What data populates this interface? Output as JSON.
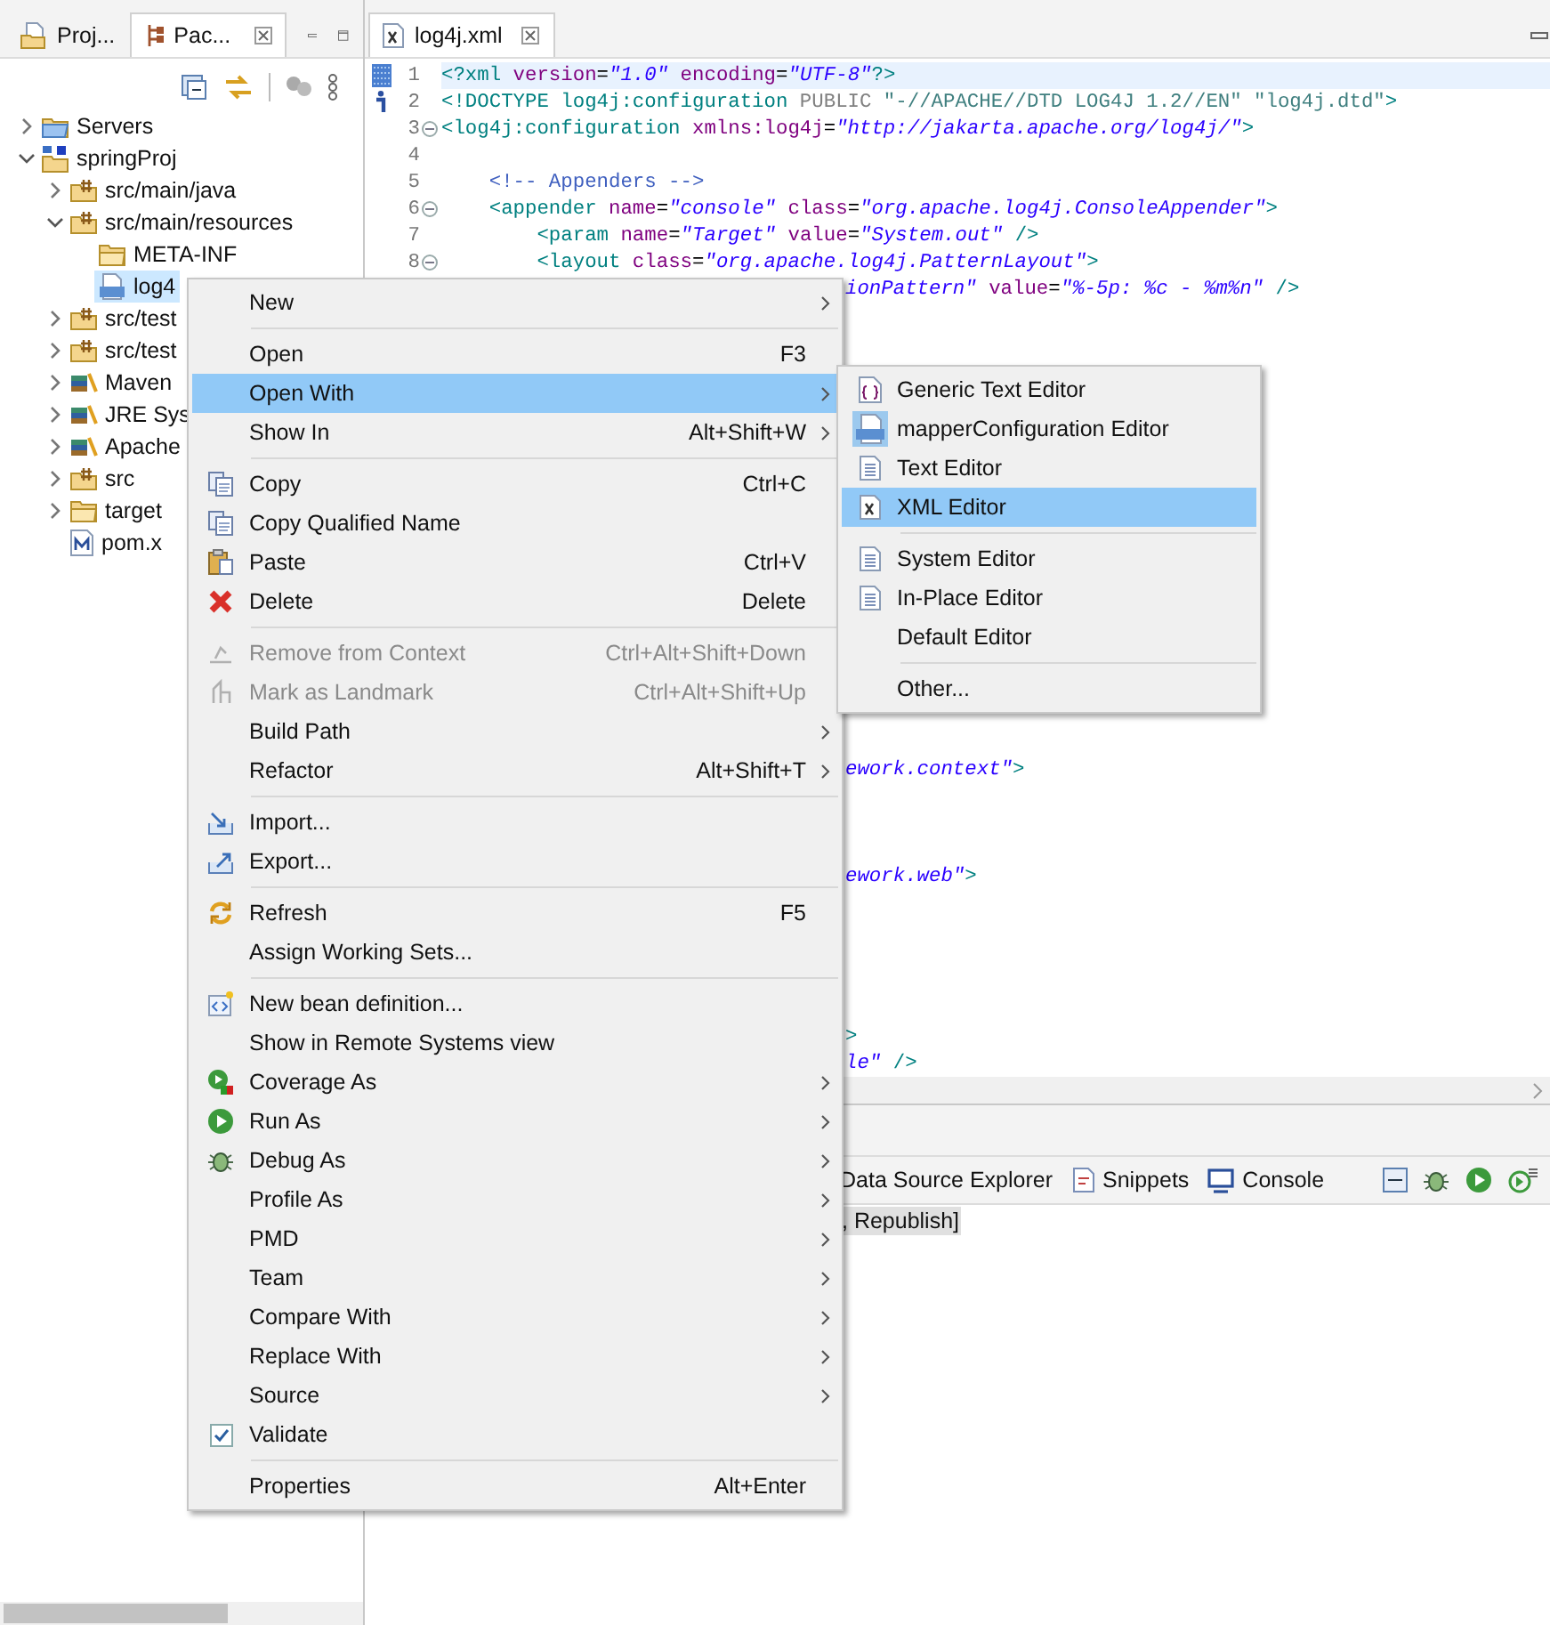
{
  "explorer": {
    "tabs": [
      {
        "label": "Proj...",
        "selected": false
      },
      {
        "label": "Pac...",
        "selected": true
      }
    ],
    "tree": [
      {
        "label": "Servers",
        "kind": "server-folder",
        "expanded": false,
        "selected": false
      },
      {
        "label": "springProj",
        "kind": "project",
        "expanded": true,
        "selected": false,
        "children": [
          {
            "label": "src/main/java",
            "kind": "package-folder",
            "expanded": false,
            "selected": false
          },
          {
            "label": "src/main/resources",
            "kind": "package-folder",
            "expanded": true,
            "selected": false,
            "children": [
              {
                "label": "META-INF",
                "kind": "folder",
                "selected": false
              },
              {
                "label": "log4",
                "kind": "config-file",
                "selected": true
              }
            ]
          },
          {
            "label": "src/test",
            "kind": "package-folder",
            "expanded": false,
            "selected": false
          },
          {
            "label": "src/test",
            "kind": "package-folder",
            "expanded": false,
            "selected": false
          },
          {
            "label": "Maven",
            "kind": "library",
            "expanded": false,
            "selected": false
          },
          {
            "label": "JRE Sys",
            "kind": "library",
            "expanded": false,
            "selected": false
          },
          {
            "label": "Apache",
            "kind": "library",
            "expanded": false,
            "selected": false
          },
          {
            "label": "src",
            "kind": "package-folder",
            "expanded": false,
            "selected": false
          },
          {
            "label": "target",
            "kind": "folder",
            "expanded": false,
            "selected": false
          },
          {
            "label": "pom.x",
            "kind": "xml-file",
            "selected": false
          }
        ]
      }
    ]
  },
  "editor": {
    "tab": {
      "label": "log4j.xml",
      "selected": true
    },
    "code_lines": [
      {
        "number": "1",
        "current": true,
        "segments": [
          {
            "kind": "tag",
            "text": "<?xml"
          },
          {
            "kind": "attr",
            "text": " version"
          },
          {
            "kind": "plain",
            "text": "="
          },
          {
            "kind": "value",
            "text": "\"1.0\""
          },
          {
            "kind": "attr",
            "text": " encoding"
          },
          {
            "kind": "plain",
            "text": "="
          },
          {
            "kind": "value",
            "text": "\"UTF-8\""
          },
          {
            "kind": "tag",
            "text": "?>"
          }
        ]
      },
      {
        "number": "2",
        "current": false,
        "segments": [
          {
            "kind": "tag",
            "text": "<!DOCTYPE log4j:configuration "
          },
          {
            "kind": "keyword",
            "text": "PUBLIC "
          },
          {
            "kind": "dstring",
            "text": "\"-//APACHE//DTD LOG4J 1.2//EN\" \"log4j.dtd\""
          },
          {
            "kind": "tag",
            "text": ">"
          }
        ]
      },
      {
        "number": "3",
        "current": false,
        "expanded": true,
        "segments": [
          {
            "kind": "tag",
            "text": "<log4j:configuration"
          },
          {
            "kind": "attr",
            "text": " xmlns:log4j"
          },
          {
            "kind": "plain",
            "text": "="
          },
          {
            "kind": "value",
            "text": "\"http://jakarta.apache.org/log4j/\""
          },
          {
            "kind": "tag",
            "text": ">"
          }
        ]
      },
      {
        "number": "4",
        "current": false
      },
      {
        "number": "5",
        "current": false,
        "segments": [
          {
            "kind": "comment",
            "text": "    <!-- Appenders -->"
          }
        ]
      },
      {
        "number": "6",
        "current": false,
        "expanded": true,
        "segments": [
          {
            "kind": "tag",
            "text": "    <appender"
          },
          {
            "kind": "attr",
            "text": " name"
          },
          {
            "kind": "plain",
            "text": "="
          },
          {
            "kind": "value",
            "text": "\"console\""
          },
          {
            "kind": "attr",
            "text": " class"
          },
          {
            "kind": "plain",
            "text": "="
          },
          {
            "kind": "value",
            "text": "\"org.apache.log4j.ConsoleAppender\""
          },
          {
            "kind": "tag",
            "text": ">"
          }
        ]
      },
      {
        "number": "7",
        "current": false,
        "segments": [
          {
            "kind": "tag",
            "text": "        <param"
          },
          {
            "kind": "attr",
            "text": " name"
          },
          {
            "kind": "plain",
            "text": "="
          },
          {
            "kind": "value",
            "text": "\"Target\""
          },
          {
            "kind": "attr",
            "text": " value"
          },
          {
            "kind": "plain",
            "text": "="
          },
          {
            "kind": "value",
            "text": "\"System.out\""
          },
          {
            "kind": "tag",
            "text": " />"
          }
        ]
      },
      {
        "number": "8",
        "current": false,
        "expanded": true,
        "segments": [
          {
            "kind": "tag",
            "text": "        <layout"
          },
          {
            "kind": "attr",
            "text": " class"
          },
          {
            "kind": "plain",
            "text": "="
          },
          {
            "kind": "value",
            "text": "\"org.apache.log4j.PatternLayout\""
          },
          {
            "kind": "tag",
            "text": ">"
          }
        ]
      }
    ],
    "visible_fragments": [
      {
        "segments": [
          {
            "kind": "value",
            "text": "ionPattern\""
          },
          {
            "kind": "attr",
            "text": " value"
          },
          {
            "kind": "plain",
            "text": "="
          },
          {
            "kind": "value",
            "text": "\"%-5p: %c - %m%n\""
          },
          {
            "kind": "tag",
            "text": " />"
          }
        ]
      },
      {
        "segments": [
          {
            "kind": "value",
            "text": "ework.context\""
          },
          {
            "kind": "tag",
            "text": ">"
          }
        ]
      },
      {
        "segments": [
          {
            "kind": "value",
            "text": "ework.web\""
          },
          {
            "kind": "tag",
            "text": ">"
          }
        ]
      },
      {
        "segments": [
          {
            "kind": "tag",
            "text": ">"
          }
        ]
      },
      {
        "segments": [
          {
            "kind": "value",
            "text": "le\""
          },
          {
            "kind": "tag",
            "text": " />"
          }
        ]
      }
    ]
  },
  "bottom_panel": {
    "tabs": [
      "Data Source Explorer",
      "Snippets",
      "Console"
    ],
    "console_text": ", Republish]"
  },
  "context_menu": {
    "items": [
      {
        "kind": "item",
        "label": "New",
        "submenu": true,
        "disabled": false,
        "selected": false,
        "checked": false
      },
      {
        "kind": "separator"
      },
      {
        "kind": "item",
        "label": "Open",
        "shortcut": "F3",
        "submenu": false,
        "disabled": false,
        "selected": false,
        "checked": false
      },
      {
        "kind": "item",
        "label": "Open With",
        "submenu": true,
        "disabled": false,
        "selected": true,
        "checked": false,
        "children": [
          {
            "kind": "item",
            "label": "Generic Text Editor",
            "selected": false
          },
          {
            "kind": "item",
            "label": "mapperConfiguration Editor",
            "selected": false
          },
          {
            "kind": "item",
            "label": "Text Editor",
            "selected": false
          },
          {
            "kind": "item",
            "label": "XML Editor",
            "selected": true
          },
          {
            "kind": "separator"
          },
          {
            "kind": "item",
            "label": "System Editor",
            "selected": false
          },
          {
            "kind": "item",
            "label": "In-Place Editor",
            "selected": false
          },
          {
            "kind": "item",
            "label": "Default Editor",
            "selected": false
          },
          {
            "kind": "separator"
          },
          {
            "kind": "item",
            "label": "Other...",
            "selected": false
          }
        ]
      },
      {
        "kind": "item",
        "label": "Show In",
        "shortcut": "Alt+Shift+W",
        "submenu": true,
        "disabled": false,
        "selected": false,
        "checked": false
      },
      {
        "kind": "separator"
      },
      {
        "kind": "item",
        "label": "Copy",
        "shortcut": "Ctrl+C",
        "submenu": false,
        "disabled": false,
        "selected": false,
        "checked": false
      },
      {
        "kind": "item",
        "label": "Copy Qualified Name",
        "submenu": false,
        "disabled": false,
        "selected": false,
        "checked": false
      },
      {
        "kind": "item",
        "label": "Paste",
        "shortcut": "Ctrl+V",
        "submenu": false,
        "disabled": false,
        "selected": false,
        "checked": false
      },
      {
        "kind": "item",
        "label": "Delete",
        "shortcut": "Delete",
        "submenu": false,
        "disabled": false,
        "selected": false,
        "checked": false
      },
      {
        "kind": "separator"
      },
      {
        "kind": "item",
        "label": "Remove from Context",
        "shortcut": "Ctrl+Alt+Shift+Down",
        "submenu": false,
        "disabled": true,
        "selected": false,
        "checked": false
      },
      {
        "kind": "item",
        "label": "Mark as Landmark",
        "shortcut": "Ctrl+Alt+Shift+Up",
        "submenu": false,
        "disabled": true,
        "selected": false,
        "checked": false
      },
      {
        "kind": "item",
        "label": "Build Path",
        "submenu": true,
        "disabled": false,
        "selected": false,
        "checked": false
      },
      {
        "kind": "item",
        "label": "Refactor",
        "shortcut": "Alt+Shift+T",
        "submenu": true,
        "disabled": false,
        "selected": false,
        "checked": false
      },
      {
        "kind": "separator"
      },
      {
        "kind": "item",
        "label": "Import...",
        "submenu": false,
        "disabled": false,
        "selected": false,
        "checked": false
      },
      {
        "kind": "item",
        "label": "Export...",
        "submenu": false,
        "disabled": false,
        "selected": false,
        "checked": false
      },
      {
        "kind": "separator"
      },
      {
        "kind": "item",
        "label": "Refresh",
        "shortcut": "F5",
        "submenu": false,
        "disabled": false,
        "selected": false,
        "checked": false
      },
      {
        "kind": "item",
        "label": "Assign Working Sets...",
        "submenu": false,
        "disabled": false,
        "selected": false,
        "checked": false
      },
      {
        "kind": "separator"
      },
      {
        "kind": "item",
        "label": "New bean definition...",
        "submenu": false,
        "disabled": false,
        "selected": false,
        "checked": false
      },
      {
        "kind": "item",
        "label": "Show in Remote Systems view",
        "submenu": false,
        "disabled": false,
        "selected": false,
        "checked": false
      },
      {
        "kind": "item",
        "label": "Coverage As",
        "submenu": true,
        "disabled": false,
        "selected": false,
        "checked": false
      },
      {
        "kind": "item",
        "label": "Run As",
        "submenu": true,
        "disabled": false,
        "selected": false,
        "checked": false
      },
      {
        "kind": "item",
        "label": "Debug As",
        "submenu": true,
        "disabled": false,
        "selected": false,
        "checked": false
      },
      {
        "kind": "item",
        "label": "Profile As",
        "submenu": true,
        "disabled": false,
        "selected": false,
        "checked": false
      },
      {
        "kind": "item",
        "label": "PMD",
        "submenu": true,
        "disabled": false,
        "selected": false,
        "checked": false
      },
      {
        "kind": "item",
        "label": "Team",
        "submenu": true,
        "disabled": false,
        "selected": false,
        "checked": false
      },
      {
        "kind": "item",
        "label": "Compare With",
        "submenu": true,
        "disabled": false,
        "selected": false,
        "checked": false
      },
      {
        "kind": "item",
        "label": "Replace With",
        "submenu": true,
        "disabled": false,
        "selected": false,
        "checked": false
      },
      {
        "kind": "item",
        "label": "Source",
        "submenu": true,
        "disabled": false,
        "selected": false,
        "checked": false
      },
      {
        "kind": "item",
        "label": "Validate",
        "submenu": false,
        "disabled": false,
        "selected": false,
        "checked": true
      },
      {
        "kind": "separator"
      },
      {
        "kind": "item",
        "label": "Properties",
        "shortcut": "Alt+Enter",
        "submenu": false,
        "disabled": false,
        "selected": false,
        "checked": false
      }
    ]
  }
}
